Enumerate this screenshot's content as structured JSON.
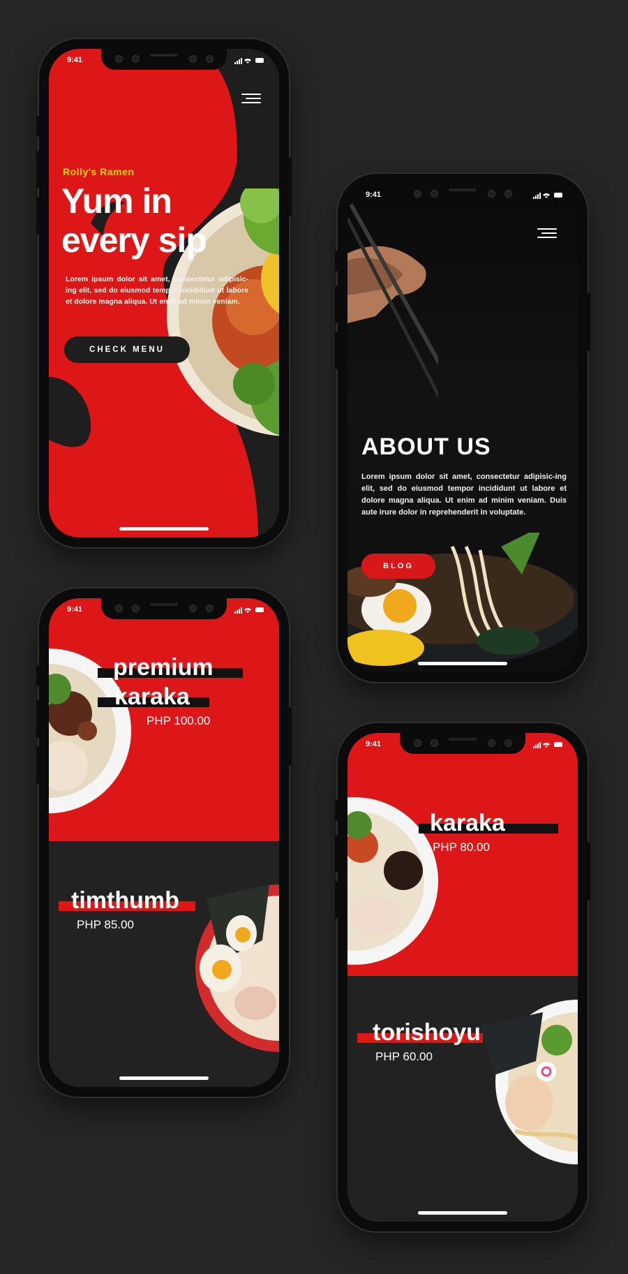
{
  "status_time": "9:41",
  "colors": {
    "red": "#dd1717",
    "dark": "#222222",
    "yellow": "#f5d400"
  },
  "phone1": {
    "brand": "Rolly's Ramen",
    "title_line1": "Yum in",
    "title_line2": "every sip",
    "body": "Lorem ipsum dolor sit amet, consectetur adipisic-ing elit, sed do eiusmod tempor incididunt ut labore et dolore magna aliqua. Ut enim ad minim veniam.",
    "cta": "CHECK MENU",
    "icons": [
      "logo-target-icon",
      "hamburger-menu-icon"
    ]
  },
  "phone2": {
    "title": "ABOUT US",
    "body": "Lorem ipsum dolor sit amet, consectetur adipisic-ing elit, sed do eiusmod tempor incididunt ut labore et dolore magna aliqua. Ut enim ad minim veniam. Duis aute irure dolor in reprehenderit in voluptate.",
    "cta": "BLOG"
  },
  "phone3": {
    "item1": {
      "name_line1": "premium",
      "name_line2": "karaka",
      "price": "PHP 100.00"
    },
    "item2": {
      "name": "timthumb",
      "price": "PHP 85.00"
    }
  },
  "phone4": {
    "item1": {
      "name": "karaka",
      "price": "PHP 80.00"
    },
    "item2": {
      "name": "torishoyu",
      "price": "PHP 60.00"
    }
  }
}
